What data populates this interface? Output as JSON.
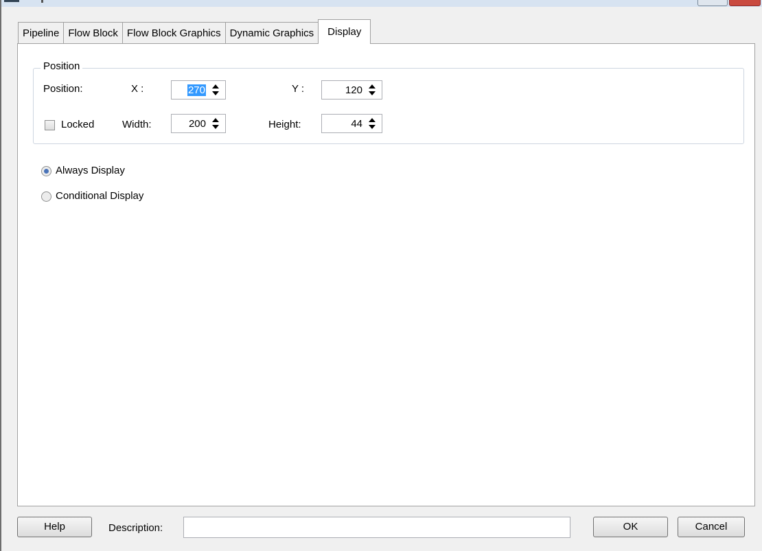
{
  "tabs": [
    {
      "label": "Pipeline"
    },
    {
      "label": "Flow Block"
    },
    {
      "label": "Flow Block Graphics"
    },
    {
      "label": "Dynamic Graphics"
    },
    {
      "label": "Display",
      "active": true
    }
  ],
  "position_group": {
    "title": "Position",
    "position_label": "Position:",
    "x_label": "X :",
    "x_value": "270",
    "y_label": "Y :",
    "y_value": "120",
    "locked_label": "Locked",
    "locked_checked": false,
    "width_label": "Width:",
    "width_value": "200",
    "height_label": "Height:",
    "height_value": "44"
  },
  "display_options": {
    "always_label": "Always Display",
    "conditional_label": "Conditional Display",
    "selected": "always"
  },
  "footer": {
    "help_label": "Help",
    "description_label": "Description:",
    "description_value": "",
    "ok_label": "OK",
    "cancel_label": "Cancel"
  },
  "colors": {
    "selection_highlight": "#3399ff",
    "radio_dot": "#4a73b8"
  }
}
